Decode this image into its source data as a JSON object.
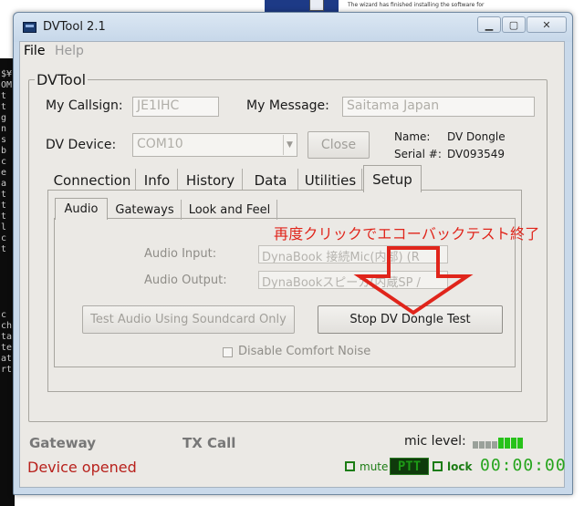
{
  "window": {
    "title": "DVTool 2.1"
  },
  "menu": {
    "file": "File",
    "help": "Help"
  },
  "group": {
    "title": "DVTool"
  },
  "callsign": {
    "label": "My Callsign:",
    "value": "JE1IHC"
  },
  "message": {
    "label": "My Message:",
    "value": "Saitama Japan"
  },
  "device": {
    "label": "DV Device:",
    "value": "COM10",
    "close_label": "Close"
  },
  "device_info": {
    "name_label": "Name:",
    "name_value": "DV Dongle",
    "serial_label": "Serial #:",
    "serial_value": "DV093549"
  },
  "tabs": [
    "Connection",
    "Info",
    "History",
    "Data",
    "Utilities",
    "Setup"
  ],
  "subtabs": [
    "Audio",
    "Gateways",
    "Look and Feel"
  ],
  "audio": {
    "input_label": "Audio Input:",
    "input_value": "DynaBook 接続Mic(内部) (R",
    "output_label": "Audio Output:",
    "output_value": "DynaBookスピーカ(内蔵SP /",
    "test_button": "Test Audio Using Soundcard Only",
    "stop_button": "Stop DV Dongle Test",
    "comfort_noise_label": "Disable Comfort Noise"
  },
  "annotation": {
    "text": "再度クリックでエコーバックテスト終了",
    "color": "#e0251b"
  },
  "status": {
    "gateway_label": "Gateway",
    "txcall_label": "TX Call",
    "message": "Device opened",
    "mic_label": "mic level:",
    "mic_level_fraction": 0.5,
    "mute_label": "mute",
    "ptt_label": "PTT",
    "lock_label": "lock",
    "timer": "00:00:00"
  },
  "background": {
    "console_lines": [
      "",
      "$¥",
      "OM",
      "t",
      "t",
      "g",
      "n",
      "s",
      "b",
      "c",
      "e",
      "a",
      "t",
      "t",
      "t",
      "l",
      "c",
      "t",
      "",
      "",
      "",
      "",
      "",
      "c",
      "ch",
      "ta",
      "te",
      "at",
      "rt"
    ],
    "installer_line1": "The wizard has finished installing the software for"
  },
  "colors": {
    "accent_red": "#e0251b",
    "led_green": "#27c21a",
    "status_red": "#b8211c"
  }
}
